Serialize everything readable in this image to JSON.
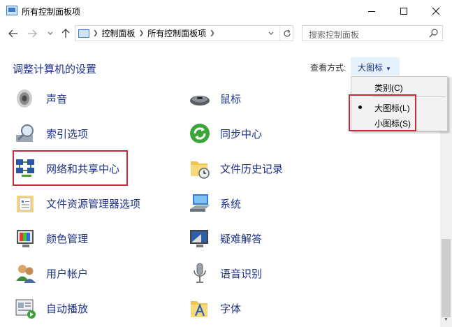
{
  "window": {
    "title": "所有控制面板项"
  },
  "address_bar": {
    "path": [
      "控制面板",
      "所有控制面板项"
    ],
    "refresh_icon": "refresh-icon"
  },
  "search": {
    "placeholder": "搜索控制面板"
  },
  "header": {
    "title": "调整计算机的设置",
    "view_by_label": "查看方式:",
    "view_by_value": "大图标"
  },
  "view_menu": {
    "items": [
      {
        "label": "类别(C)",
        "selected": false
      },
      {
        "label": "大图标(L)",
        "selected": true
      },
      {
        "label": "小图标(S)",
        "selected": false
      }
    ]
  },
  "items_left": [
    {
      "label": "声音",
      "icon": "speaker-icon"
    },
    {
      "label": "索引选项",
      "icon": "index-search-icon"
    },
    {
      "label": "网络和共享中心",
      "icon": "network-icon"
    },
    {
      "label": "文件资源管理器选项",
      "icon": "folder-options-icon"
    },
    {
      "label": "颜色管理",
      "icon": "color-management-icon"
    },
    {
      "label": "用户帐户",
      "icon": "users-icon"
    },
    {
      "label": "自动播放",
      "icon": "autoplay-icon"
    }
  ],
  "items_right": [
    {
      "label": "鼠标",
      "icon": "mouse-icon"
    },
    {
      "label": "同步中心",
      "icon": "sync-icon"
    },
    {
      "label": "文件历史记录",
      "icon": "file-history-icon"
    },
    {
      "label": "系统",
      "icon": "system-icon"
    },
    {
      "label": "疑难解答",
      "icon": "troubleshoot-icon"
    },
    {
      "label": "语音识别",
      "icon": "microphone-icon"
    },
    {
      "label": "字体",
      "icon": "fonts-icon"
    }
  ],
  "colors": {
    "link": "#1e3287",
    "highlight_box": "#c82a3a",
    "view_button_bg": "#e5f1fb"
  }
}
